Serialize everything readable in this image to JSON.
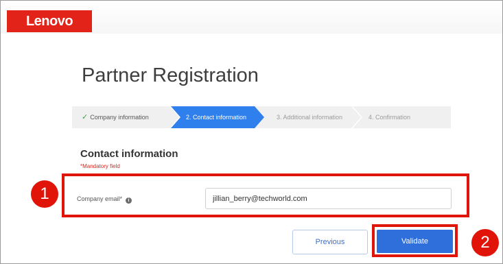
{
  "brand": {
    "logo_text": "Lenovo",
    "color": "#e2231a"
  },
  "page": {
    "title": "Partner Registration"
  },
  "stepper": {
    "steps": [
      {
        "label": "Company information",
        "state": "done",
        "icon": "check-icon"
      },
      {
        "label": "2. Contact information",
        "state": "active"
      },
      {
        "label": "3. Additional information",
        "state": "inactive"
      },
      {
        "label": "4. Confirmation",
        "state": "inactive"
      }
    ],
    "active_color": "#2f80ed"
  },
  "section": {
    "title": "Contact information",
    "mandatory_note": "*Mandatory field"
  },
  "form": {
    "email_label": "Company email*",
    "email_value": "jillian_berry@techworld.com",
    "info_icon": "i"
  },
  "buttons": {
    "previous_label": "Previous",
    "validate_label": "Validate"
  },
  "annotations": {
    "badge1": "1",
    "badge2": "2",
    "highlight_color": "#e1140a"
  }
}
